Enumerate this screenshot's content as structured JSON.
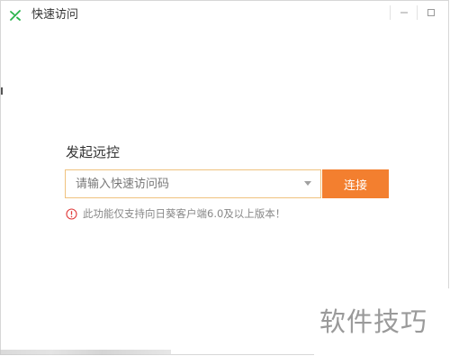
{
  "window": {
    "title": "快速访问",
    "controls": {
      "minimize_icon": "minimize-icon",
      "maximize_icon": "maximize-icon"
    }
  },
  "main": {
    "section_title": "发起远控",
    "access_code_input": {
      "value": "",
      "placeholder": "请输入快速访问码"
    },
    "connect_label": "连接",
    "hint_text": "此功能仅支持向日葵客户端6.0及以上版本！",
    "hint_icon": "warning-circle-icon"
  },
  "watermark": "软件技巧",
  "colors": {
    "accent": "#f37f2f",
    "input_border": "#f0c27e",
    "logo_green": "#29b34a",
    "warning_red": "#e03b3b"
  }
}
